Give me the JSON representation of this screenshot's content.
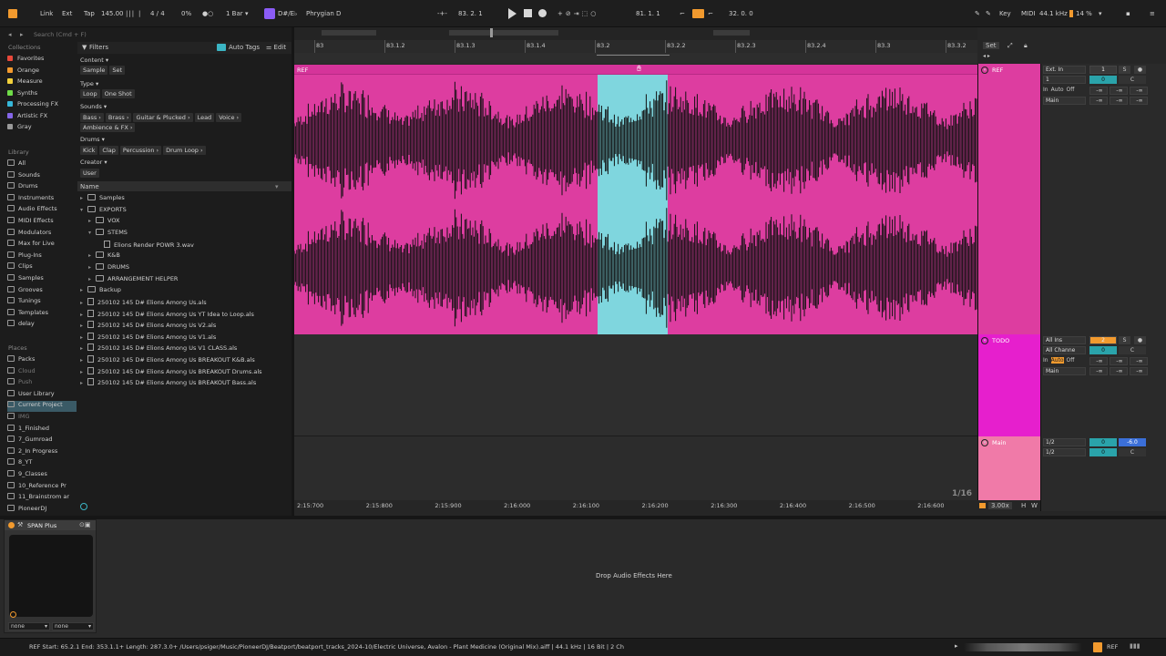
{
  "transport": {
    "link": "Link",
    "ext": "Ext",
    "tap": "Tap",
    "tempo": "145.00",
    "signature": "4 / 4",
    "cpu_pct": "0%",
    "quantize": "1 Bar",
    "key_scale_root": "D#/E♭",
    "scale": "Phrygian D",
    "position": "83.  2.  1",
    "loop_start": "81.  1.  1",
    "loop_length": "32.  0.  0",
    "key_label": "Key",
    "midi_label": "MIDI",
    "sample_rate": "44.1 kHz",
    "cpu_load": "14 %"
  },
  "browser": {
    "search_placeholder": "Search (Cmd + F)",
    "collections_title": "Collections",
    "collections": [
      {
        "label": "Favorites",
        "color": "#e8483a"
      },
      {
        "label": "Orange",
        "color": "#f29a2e"
      },
      {
        "label": "Measure",
        "color": "#f2d03b"
      },
      {
        "label": "Synths",
        "color": "#6fdc48"
      },
      {
        "label": "Processing FX",
        "color": "#36b7d9"
      },
      {
        "label": "Artistic FX",
        "color": "#8566e8"
      },
      {
        "label": "Gray",
        "color": "#9a9a9a"
      }
    ],
    "library_title": "Library",
    "library": [
      "All",
      "Sounds",
      "Drums",
      "Instruments",
      "Audio Effects",
      "MIDI Effects",
      "Modulators",
      "Max for Live",
      "Plug-Ins",
      "Clips",
      "Samples",
      "Grooves",
      "Tunings",
      "Templates",
      "delay"
    ],
    "places_title": "Places",
    "places": [
      "Packs",
      "Cloud",
      "Push",
      "User Library",
      "Current Project",
      "IMG",
      "1_Finished",
      "7_Gumroad",
      "2_In Progress",
      "8_YT",
      "9_Classes",
      "10_Reference Pr",
      "11_Brainstrom ar",
      "PioneerDJ"
    ],
    "filters_label": "Filters",
    "auto_tags": "Auto Tags",
    "edit": "Edit",
    "content_label": "Content",
    "content_chips": [
      "Sample",
      "Set"
    ],
    "type_label": "Type",
    "type_chips": [
      "Loop",
      "One Shot"
    ],
    "sounds_label": "Sounds",
    "sounds_chips": [
      "Bass ›",
      "Brass ›",
      "Guitar & Plucked ›",
      "Lead",
      "Voice ›"
    ],
    "sounds_chips2": [
      "Ambience & FX ›"
    ],
    "drums_label": "Drums",
    "drums_chips": [
      "Kick",
      "Clap",
      "Percussion ›",
      "Drum Loop ›"
    ],
    "creator_label": "Creator",
    "creator_chips": [
      "User"
    ],
    "name_header": "Name",
    "tree": [
      {
        "label": "Samples",
        "indent": 0,
        "kind": "folder",
        "open": false
      },
      {
        "label": "EXPORTS",
        "indent": 0,
        "kind": "folder",
        "open": true
      },
      {
        "label": "VOX",
        "indent": 1,
        "kind": "folder",
        "open": false
      },
      {
        "label": "STEMS",
        "indent": 1,
        "kind": "folder",
        "open": true
      },
      {
        "label": "Elions Render POWR 3.wav",
        "indent": 2,
        "kind": "wav",
        "open": false
      },
      {
        "label": "K&B",
        "indent": 1,
        "kind": "folder",
        "open": false
      },
      {
        "label": "DRUMS",
        "indent": 1,
        "kind": "folder",
        "open": false
      },
      {
        "label": "ARRANGEMENT HELPER",
        "indent": 1,
        "kind": "folder",
        "open": false
      },
      {
        "label": "Backup",
        "indent": 0,
        "kind": "folder",
        "open": false
      },
      {
        "label": "250102 145 D# Elions Among Us.als",
        "indent": 0,
        "kind": "file",
        "open": false
      },
      {
        "label": "250102 145 D# Elions Among Us YT Idea to Loop.als",
        "indent": 0,
        "kind": "file",
        "open": false
      },
      {
        "label": "250102 145 D# Elions Among Us V2.als",
        "indent": 0,
        "kind": "file",
        "open": false
      },
      {
        "label": "250102 145 D# Elions Among Us V1.als",
        "indent": 0,
        "kind": "file",
        "open": false
      },
      {
        "label": "250102 145 D# Elions Among Us V1 CLASS.als",
        "indent": 0,
        "kind": "file",
        "open": false
      },
      {
        "label": "250102 145 D# Elions Among Us BREAKOUT K&B.als",
        "indent": 0,
        "kind": "file",
        "open": false
      },
      {
        "label": "250102 145 D# Elions Among Us BREAKOUT Drums.als",
        "indent": 0,
        "kind": "file",
        "open": false
      },
      {
        "label": "250102 145 D# Elions Among Us BREAKOUT Bass.als",
        "indent": 0,
        "kind": "file",
        "open": false
      }
    ]
  },
  "arrangement": {
    "bar_ticks": [
      "83",
      "83.1.2",
      "83.1.3",
      "83.1.4",
      "83.2",
      "83.2.2",
      "83.2.3",
      "83.2.4",
      "83.3",
      "83.3.2"
    ],
    "time_ticks": [
      "2:15:700",
      "2:15:800",
      "2:15:900",
      "2:16:000",
      "2:16:100",
      "2:16:200",
      "2:16:300",
      "2:16:400",
      "2:16:500",
      "2:16:600"
    ],
    "set_label": "Set",
    "clip_name": "REF",
    "grid": "1/16",
    "zoom": "3.00x",
    "h": "H",
    "w": "W"
  },
  "tracks": [
    {
      "name": "REF",
      "color": "#dd3da0",
      "input": "Ext. In",
      "channel": "1",
      "output": "Main",
      "number": "1",
      "number_color": "#3a3a3a",
      "volume": "0",
      "pan": "C",
      "monitor_in": "In",
      "monitor_auto": "Auto",
      "monitor_off": "Off",
      "send_a": "-∞",
      "send_b": "-∞",
      "send_c": "-∞",
      "send_d": "-∞"
    },
    {
      "name": "TODO",
      "color": "#e61fcd",
      "input": "All Ins",
      "channel": "All Channe",
      "output": "Main",
      "number": "2",
      "number_color": "#f29a2e",
      "volume": "0",
      "pan": "C",
      "monitor_in": "In",
      "monitor_auto": "Auto",
      "monitor_off": "Off",
      "send_a": "-∞",
      "send_b": "-∞",
      "send_c": "-∞",
      "send_d": "-∞"
    },
    {
      "name": "Main",
      "color": "#f07aa8",
      "input": "1/2",
      "channel": "1/2",
      "output": "",
      "number": "",
      "number_color": "",
      "volume": "0",
      "pan": "C",
      "main_vol": "-6.0"
    }
  ],
  "devices": {
    "plugin_name": "SPAN Plus",
    "drop_text": "Drop Audio Effects Here",
    "select_a": "none",
    "select_b": "none"
  },
  "status": {
    "text": "REF  Start: 65.2.1  End: 353.1.1+  Length: 287.3.0+  /Users/psiger/Music/PioneerDJ/Beatport/beatport_tracks_2024-10/Electric Universe, Avalon - Plant Medicine (Original Mix).aiff | 44.1 kHz | 16 Bit | 2 Ch",
    "track": "REF"
  }
}
